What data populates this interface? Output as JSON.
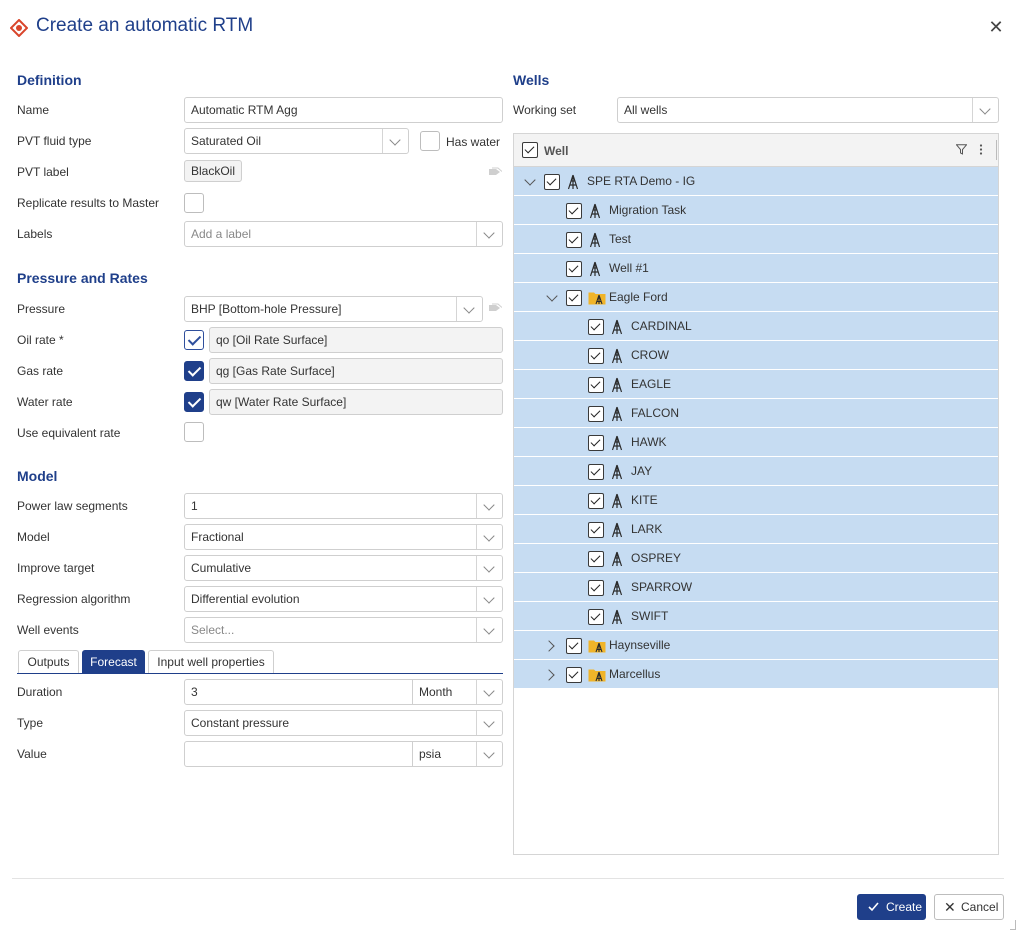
{
  "dialog": {
    "title": "Create an automatic RTM",
    "close_icon": "close-icon"
  },
  "definition": {
    "heading": "Definition",
    "name_label": "Name",
    "name_value": "Automatic RTM Agg",
    "pvt_fluid_label": "PVT fluid type",
    "pvt_fluid_value": "Saturated Oil",
    "has_water_label": "Has water",
    "has_water_checked": false,
    "pvt_label_label": "PVT label",
    "pvt_label_chip": "BlackOil",
    "replicate_label": "Replicate results to Master",
    "replicate_checked": false,
    "labels_label": "Labels",
    "labels_placeholder": "Add a label"
  },
  "pressure_rates": {
    "heading": "Pressure and Rates",
    "pressure_label": "Pressure",
    "pressure_value": "BHP [Bottom-hole Pressure]",
    "oil_label": "Oil rate *",
    "oil_value": "qo [Oil Rate Surface]",
    "gas_label": "Gas rate",
    "gas_value": "qg [Gas Rate Surface]",
    "water_label": "Water rate",
    "water_value": "qw [Water Rate Surface]",
    "equiv_label": "Use equivalent rate"
  },
  "model": {
    "heading": "Model",
    "power_label": "Power law segments",
    "power_value": "1",
    "model_label": "Model",
    "model_value": "Fractional",
    "improve_label": "Improve target",
    "improve_value": "Cumulative",
    "regression_label": "Regression algorithm",
    "regression_value": "Differential evolution",
    "events_label": "Well events",
    "events_placeholder": "Select..."
  },
  "tabs": [
    {
      "label": "Outputs",
      "active": false
    },
    {
      "label": "Forecast",
      "active": true
    },
    {
      "label": "Input well properties",
      "active": false
    }
  ],
  "forecast": {
    "duration_label": "Duration",
    "duration_value": "3",
    "duration_unit": "Month",
    "type_label": "Type",
    "type_value": "Constant pressure",
    "value_label": "Value",
    "value_value": "",
    "value_unit": "psia"
  },
  "wells": {
    "heading": "Wells",
    "working_set_label": "Working set",
    "working_set_value": "All wells",
    "column_header": "Well",
    "rows": [
      {
        "label": "SPE RTA Demo - IG",
        "level": 0,
        "expander": "open",
        "icon": "well-icon"
      },
      {
        "label": "Migration Task",
        "level": 1,
        "expander": "none",
        "icon": "well-icon"
      },
      {
        "label": "Test",
        "level": 1,
        "expander": "none",
        "icon": "well-icon"
      },
      {
        "label": "Well #1",
        "level": 1,
        "expander": "none",
        "icon": "well-icon"
      },
      {
        "label": "Eagle Ford",
        "level": 1,
        "expander": "open",
        "icon": "folder-well-icon"
      },
      {
        "label": "CARDINAL",
        "level": 2,
        "expander": "none",
        "icon": "well-icon"
      },
      {
        "label": "CROW",
        "level": 2,
        "expander": "none",
        "icon": "well-icon"
      },
      {
        "label": "EAGLE",
        "level": 2,
        "expander": "none",
        "icon": "well-icon"
      },
      {
        "label": "FALCON",
        "level": 2,
        "expander": "none",
        "icon": "well-icon"
      },
      {
        "label": "HAWK",
        "level": 2,
        "expander": "none",
        "icon": "well-icon"
      },
      {
        "label": "JAY",
        "level": 2,
        "expander": "none",
        "icon": "well-icon"
      },
      {
        "label": "KITE",
        "level": 2,
        "expander": "none",
        "icon": "well-icon"
      },
      {
        "label": "LARK",
        "level": 2,
        "expander": "none",
        "icon": "well-icon"
      },
      {
        "label": "OSPREY",
        "level": 2,
        "expander": "none",
        "icon": "well-icon"
      },
      {
        "label": "SPARROW",
        "level": 2,
        "expander": "none",
        "icon": "well-icon"
      },
      {
        "label": "SWIFT",
        "level": 2,
        "expander": "none",
        "icon": "well-icon"
      },
      {
        "label": "Haynseville",
        "level": 1,
        "expander": "closed",
        "icon": "folder-well-icon"
      },
      {
        "label": "Marcellus",
        "level": 1,
        "expander": "closed",
        "icon": "folder-well-icon"
      }
    ]
  },
  "footer": {
    "create_label": "Create",
    "cancel_label": "Cancel"
  },
  "colors": {
    "accent": "#1f3f8a",
    "row_selected": "#c6dcf2"
  }
}
